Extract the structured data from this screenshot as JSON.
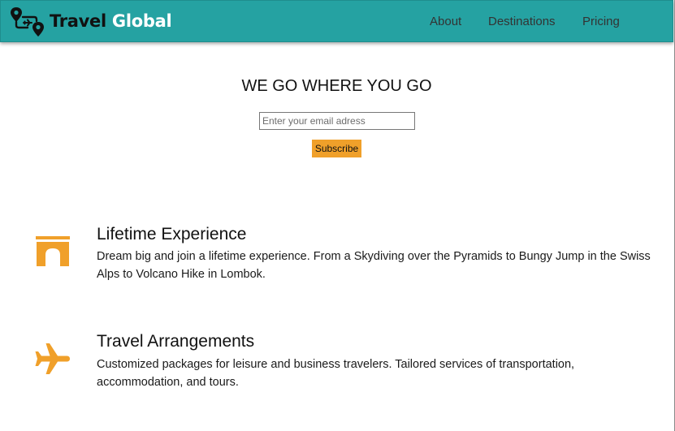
{
  "header": {
    "brand_part1": "Travel",
    "brand_part2": "Global",
    "logo_icon": "travel-route-map-icon",
    "nav": [
      "About",
      "Destinations",
      "Pricing"
    ]
  },
  "hero": {
    "title": "WE GO WHERE YOU GO",
    "email_placeholder": "Enter your email adress",
    "subscribe_label": "Subscribe"
  },
  "features": [
    {
      "icon": "arch-icon",
      "title": "Lifetime Experience",
      "text": "Dream big and join a lifetime experience. From a Skydiving over the Pyramids to Bungy Jump in the Swiss Alps to Volcano Hike in Lombok."
    },
    {
      "icon": "airplane-icon",
      "title": "Travel Arrangements",
      "text": "Customized packages for leisure and business travelers. Tailored services of transportation, accommodation, and tours."
    }
  ],
  "colors": {
    "header_bg": "#25a2a2",
    "accent": "#f0a02a",
    "brand_highlight": "#ffffff"
  }
}
